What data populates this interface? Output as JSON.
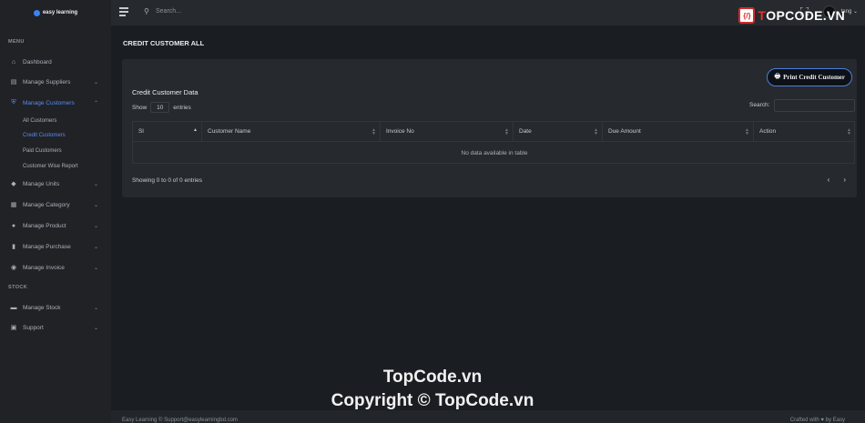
{
  "brand": {
    "name": "easy learning"
  },
  "sidebar": {
    "section_menu": "MENU",
    "section_stock": "STOCK",
    "items": [
      {
        "label": "Dashboard",
        "icon": "home-icon"
      },
      {
        "label": "Manage Suppliers",
        "icon": "suppliers-icon"
      },
      {
        "label": "Manage Customers",
        "icon": "shield-icon"
      },
      {
        "label": "Manage Units",
        "icon": "units-icon"
      },
      {
        "label": "Manage Category",
        "icon": "grid-icon"
      },
      {
        "label": "Manage Product",
        "icon": "product-icon"
      },
      {
        "label": "Manage Purchase",
        "icon": "building-icon"
      },
      {
        "label": "Manage Invoice",
        "icon": "invoice-icon"
      },
      {
        "label": "Manage Stock",
        "icon": "stock-icon"
      },
      {
        "label": "Support",
        "icon": "support-icon"
      }
    ],
    "customer_subitems": [
      "All Customers",
      "Credit Customers",
      "Paid Customers",
      "Customer Wise Report"
    ]
  },
  "topbar": {
    "search_placeholder": "Search...",
    "username": "tang"
  },
  "watermark": {
    "logo_prefix": "T",
    "logo_brand": "OPCODE.VN",
    "center_line1": "TopCode.vn",
    "center_line2": "Copyright © TopCode.vn"
  },
  "page": {
    "title": "CREDIT CUSTOMER ALL"
  },
  "card": {
    "print_button": "Print Credit Customer",
    "title": "Credit Customer Data",
    "show_label": "Show",
    "entries_value": "10",
    "entries_label": "entries",
    "search_label": "Search:",
    "columns": [
      "Sl",
      "Customer Name",
      "Invoice No",
      "Date",
      "Due Amount",
      "Action"
    ],
    "empty_message": "No data available in table",
    "info": "Showing 0 to 0 of 0 entries",
    "prev": "‹",
    "next": "›"
  },
  "footer": {
    "left": "Easy Learning © Support@easylearningbd.com",
    "right": "Crafted with ♥ by Easy"
  },
  "colors": {
    "accent": "#5b8cf0",
    "bg": "#1a1d21",
    "sidebar": "#202226",
    "card": "#262a2f"
  }
}
